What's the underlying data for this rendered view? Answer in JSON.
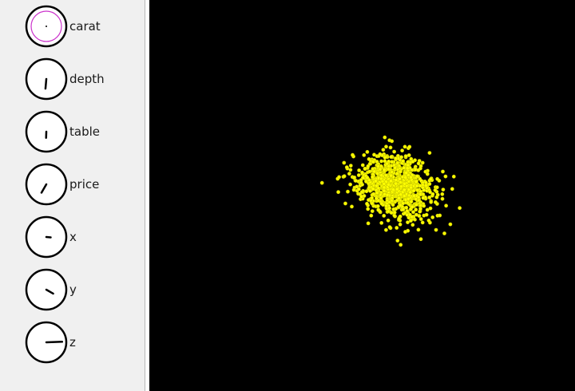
{
  "variables": [
    {
      "label": "carat",
      "selected": true,
      "angle_deg": 0,
      "length": 0
    },
    {
      "label": "depth",
      "selected": false,
      "angle_deg": 185,
      "length": 0.55
    },
    {
      "label": "table",
      "selected": false,
      "angle_deg": 182,
      "length": 0.35
    },
    {
      "label": "price",
      "selected": false,
      "angle_deg": 210,
      "length": 0.55
    },
    {
      "label": "x",
      "selected": false,
      "angle_deg": 95,
      "length": 0.25
    },
    {
      "label": "y",
      "selected": false,
      "angle_deg": 120,
      "length": 0.45
    },
    {
      "label": "z",
      "selected": false,
      "angle_deg": 88,
      "length": 0.9
    }
  ],
  "colors": {
    "panel_bg": "#f0f0f0",
    "plot_bg": "#000000",
    "point": "#ffff00",
    "point_stroke": "#c8c800",
    "dial_selected": "#cc33cc",
    "dial_outline": "#000000"
  },
  "chart_data": {
    "type": "scatter",
    "title": "",
    "xlabel": "",
    "ylabel": "",
    "grid": false,
    "cluster": {
      "center": [
        0.56,
        0.44
      ],
      "spread": [
        0.055,
        0.045
      ],
      "count": 900,
      "tail": [
        0.06,
        0.15
      ]
    }
  }
}
